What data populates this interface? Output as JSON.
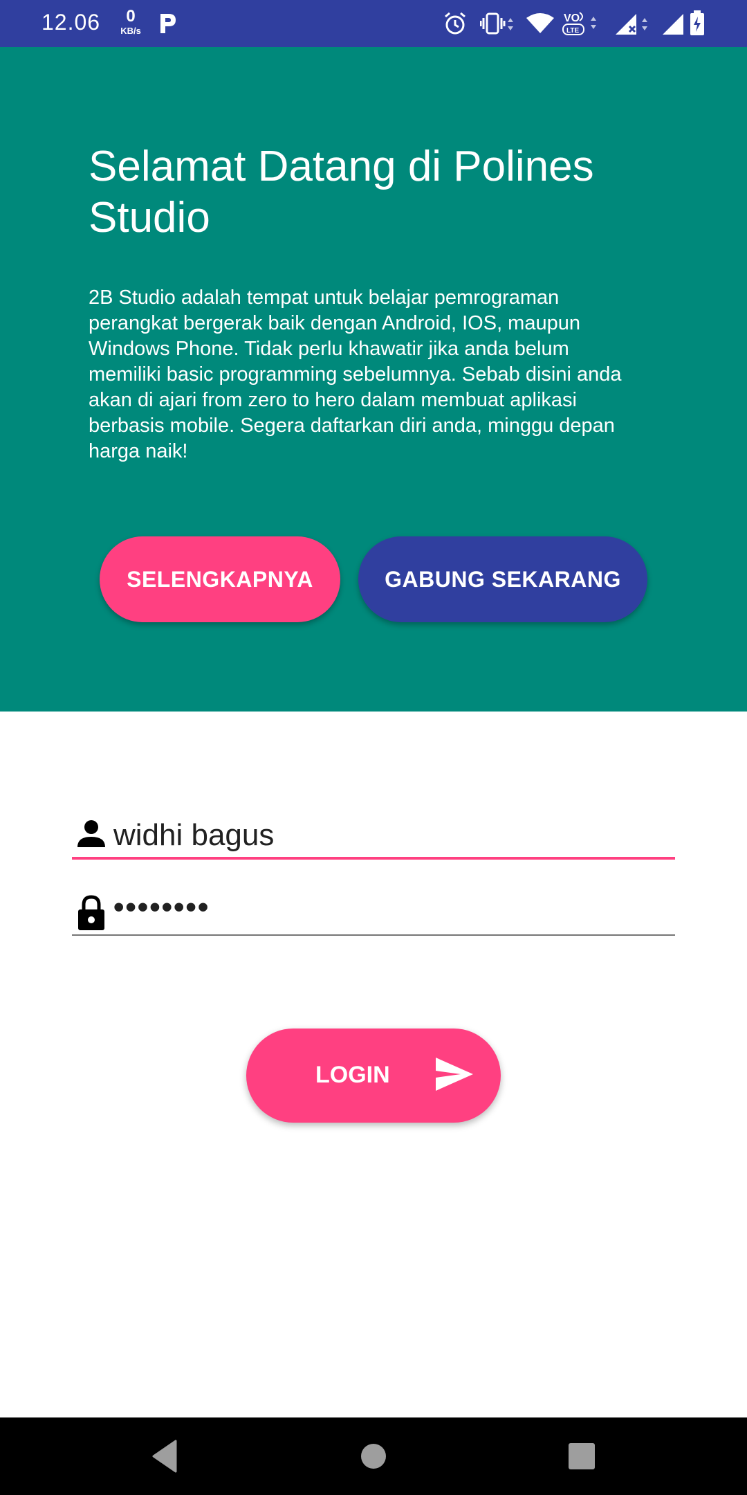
{
  "status_bar": {
    "time": "12.06",
    "net_speed_value": "0",
    "net_speed_unit": "KB/s",
    "icons": [
      "p-app-icon",
      "alarm-icon",
      "vibrate-icon",
      "wifi-icon",
      "volte-icon",
      "signal-icon",
      "signal-icon",
      "battery-charging-icon"
    ]
  },
  "hero": {
    "title": "Selamat Datang di Polines Studio",
    "description": "2B Studio adalah tempat untuk belajar pemrograman perangkat bergerak baik dengan Android, IOS, maupun Windows Phone. Tidak perlu khawatir jika anda belum memiliki basic programming sebelumnya. Sebab disini anda akan di ajari from zero to hero dalam membuat aplikasi berbasis mobile. Segera daftarkan diri anda, minggu depan harga naik!",
    "more_label": "SELENGKAPNYA",
    "join_label": "GABUNG SEKARANG"
  },
  "login": {
    "username_value": "widhi bagus",
    "password_value": "••••••••",
    "button_label": "LOGIN",
    "username_icon": "person-icon",
    "password_icon": "lock-icon",
    "button_icon": "send-icon"
  },
  "colors": {
    "status_bar": "#303F9F",
    "hero_bg": "#00897B",
    "accent": "#FF4081",
    "primary": "#303F9F",
    "nav_bar": "#000000"
  }
}
